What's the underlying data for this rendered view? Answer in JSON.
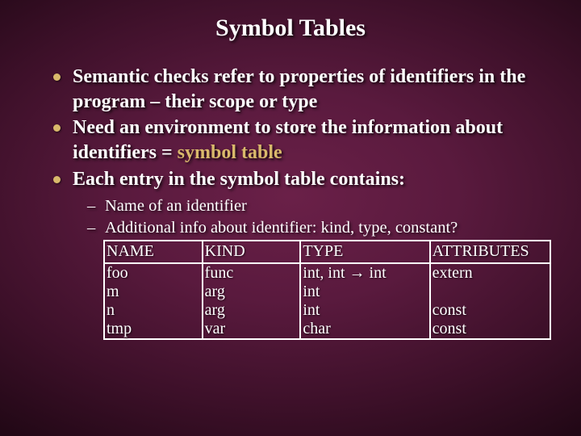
{
  "title": "Symbol Tables",
  "bullets": [
    {
      "text": "Semantic checks refer to properties of identifiers in the program – their scope or type"
    },
    {
      "pre": "Need an environment to store the information about identifiers = ",
      "highlight": "symbol table"
    },
    {
      "text": "Each entry in the symbol table contains:"
    }
  ],
  "sub_bullets": [
    "Name of an identifier",
    "Additional info about identifier: kind, type, constant?"
  ],
  "table": {
    "headers": [
      "NAME",
      "KIND",
      "TYPE",
      "ATTRIBUTES"
    ],
    "rows": [
      {
        "name": "foo",
        "kind": "func",
        "type_pre": "int, int ",
        "type_arrow": "→",
        "type_post": " int",
        "attr": "extern"
      },
      {
        "name": "m",
        "kind": "arg",
        "type_pre": "int",
        "type_arrow": "",
        "type_post": "",
        "attr": ""
      },
      {
        "name": "n",
        "kind": "arg",
        "type_pre": "int",
        "type_arrow": "",
        "type_post": "",
        "attr": "const"
      },
      {
        "name": "tmp",
        "kind": "var",
        "type_pre": "char",
        "type_arrow": "",
        "type_post": "",
        "attr": "const"
      }
    ]
  }
}
